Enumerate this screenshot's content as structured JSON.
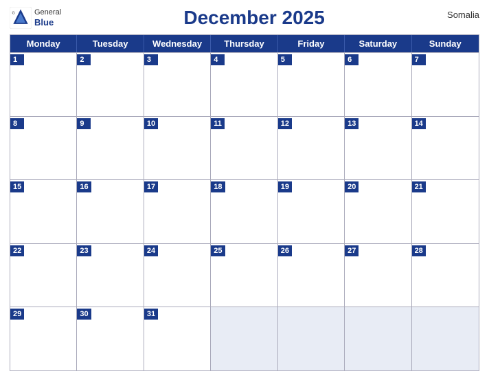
{
  "header": {
    "logo_general": "General",
    "logo_blue": "Blue",
    "title": "December 2025",
    "country": "Somalia"
  },
  "days": [
    "Monday",
    "Tuesday",
    "Wednesday",
    "Thursday",
    "Friday",
    "Saturday",
    "Sunday"
  ],
  "weeks": [
    [
      {
        "num": "1",
        "empty": false
      },
      {
        "num": "2",
        "empty": false
      },
      {
        "num": "3",
        "empty": false
      },
      {
        "num": "4",
        "empty": false
      },
      {
        "num": "5",
        "empty": false
      },
      {
        "num": "6",
        "empty": false
      },
      {
        "num": "7",
        "empty": false
      }
    ],
    [
      {
        "num": "8",
        "empty": false
      },
      {
        "num": "9",
        "empty": false
      },
      {
        "num": "10",
        "empty": false
      },
      {
        "num": "11",
        "empty": false
      },
      {
        "num": "12",
        "empty": false
      },
      {
        "num": "13",
        "empty": false
      },
      {
        "num": "14",
        "empty": false
      }
    ],
    [
      {
        "num": "15",
        "empty": false
      },
      {
        "num": "16",
        "empty": false
      },
      {
        "num": "17",
        "empty": false
      },
      {
        "num": "18",
        "empty": false
      },
      {
        "num": "19",
        "empty": false
      },
      {
        "num": "20",
        "empty": false
      },
      {
        "num": "21",
        "empty": false
      }
    ],
    [
      {
        "num": "22",
        "empty": false
      },
      {
        "num": "23",
        "empty": false
      },
      {
        "num": "24",
        "empty": false
      },
      {
        "num": "25",
        "empty": false
      },
      {
        "num": "26",
        "empty": false
      },
      {
        "num": "27",
        "empty": false
      },
      {
        "num": "28",
        "empty": false
      }
    ],
    [
      {
        "num": "29",
        "empty": false
      },
      {
        "num": "30",
        "empty": false
      },
      {
        "num": "31",
        "empty": false
      },
      {
        "num": "",
        "empty": true
      },
      {
        "num": "",
        "empty": true
      },
      {
        "num": "",
        "empty": true
      },
      {
        "num": "",
        "empty": true
      }
    ]
  ]
}
